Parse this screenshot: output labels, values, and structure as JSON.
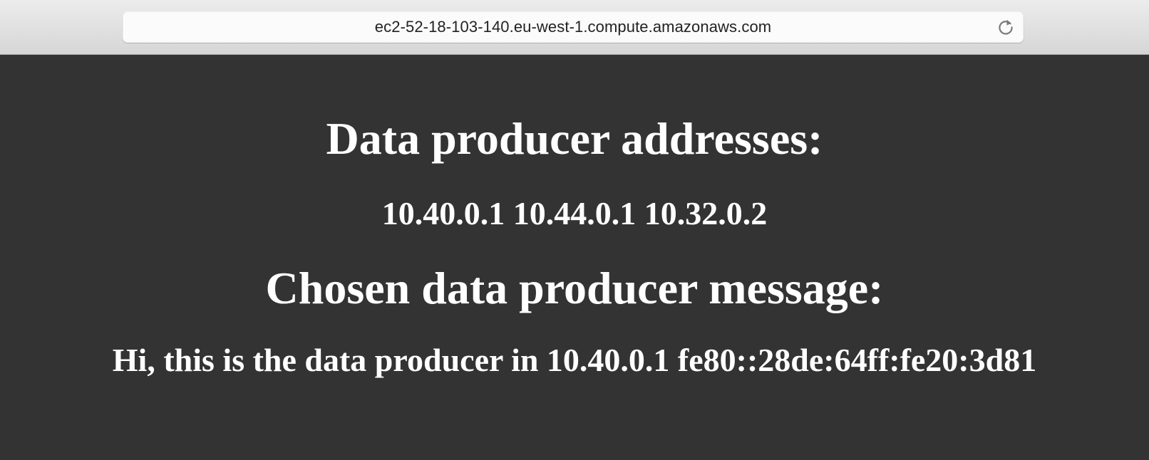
{
  "browser": {
    "url": "ec2-52-18-103-140.eu-west-1.compute.amazonaws.com",
    "reload_icon": "reload-icon"
  },
  "content": {
    "addresses_heading": "Data producer addresses:",
    "addresses": "10.40.0.1 10.44.0.1 10.32.0.2",
    "message_heading": "Chosen data producer message:",
    "message": "Hi, this is the data producer in 10.40.0.1 fe80::28de:64ff:fe20:3d81"
  },
  "colors": {
    "page_background": "#333333",
    "text": "#ffffff",
    "toolbar": "#dcdcdc"
  }
}
